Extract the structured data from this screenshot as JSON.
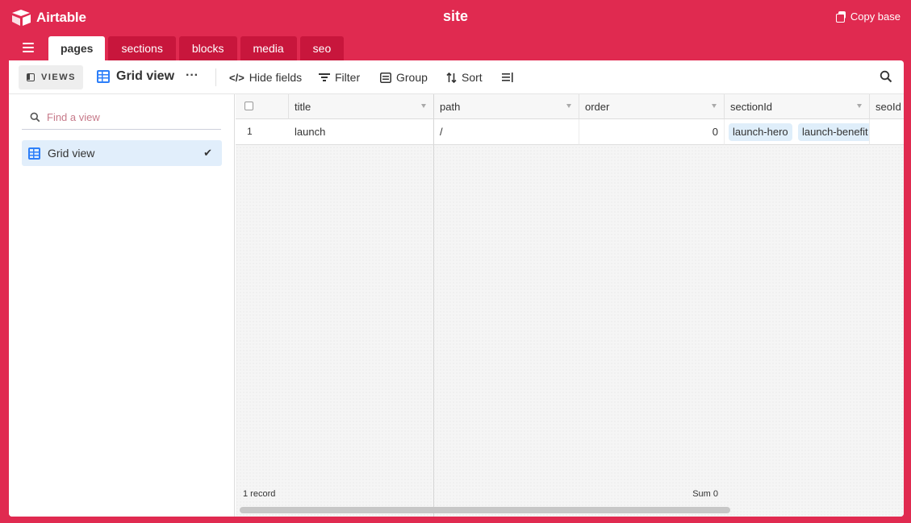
{
  "app": {
    "logo_text": "Airtable",
    "base_title": "site",
    "copy_base_label": "Copy base"
  },
  "tabs": [
    {
      "label": "pages",
      "active": true
    },
    {
      "label": "sections",
      "active": false
    },
    {
      "label": "blocks",
      "active": false
    },
    {
      "label": "media",
      "active": false
    },
    {
      "label": "seo",
      "active": false
    }
  ],
  "viewbar": {
    "views_label": "VIEWS",
    "current_view": "Grid view",
    "more": "···",
    "hide_fields": "Hide fields",
    "filter": "Filter",
    "group": "Group",
    "sort": "Sort"
  },
  "sidebar": {
    "find_placeholder": "Find a view",
    "views": [
      {
        "label": "Grid view",
        "selected": true
      }
    ]
  },
  "grid": {
    "columns": [
      "title",
      "path",
      "order",
      "sectionId",
      "seoId"
    ],
    "rows": [
      {
        "number": "1",
        "title": "launch",
        "path": "/",
        "order": "0",
        "sectionId": [
          "launch-hero",
          "launch-benefit"
        ],
        "seoId": ""
      }
    ],
    "footer_records": "1 record",
    "footer_sum": "Sum 0"
  },
  "colors": {
    "brand": "#e02a50",
    "tab_inactive": "#c8163c",
    "accent_blue": "#2d7ff9",
    "selected_view_bg": "#e1eefb"
  }
}
